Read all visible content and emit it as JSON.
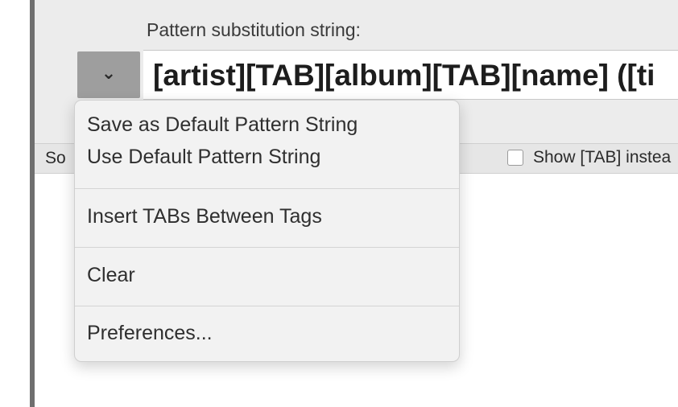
{
  "header": {
    "pattern_label": "Pattern substitution string:",
    "pattern_value": "[artist][TAB][album][TAB][name] ([ti"
  },
  "dropdown": {
    "icon": "chevron-down-icon",
    "glyph": "⌄"
  },
  "toolbar": {
    "sort_label_partial": "So",
    "show_tab_label": "Show [TAB] instea",
    "show_tab_checked": false
  },
  "menu": {
    "items": [
      "Save as Default Pattern String",
      "Use Default Pattern String",
      "Insert TABs Between Tags",
      "Clear",
      "Preferences..."
    ]
  }
}
